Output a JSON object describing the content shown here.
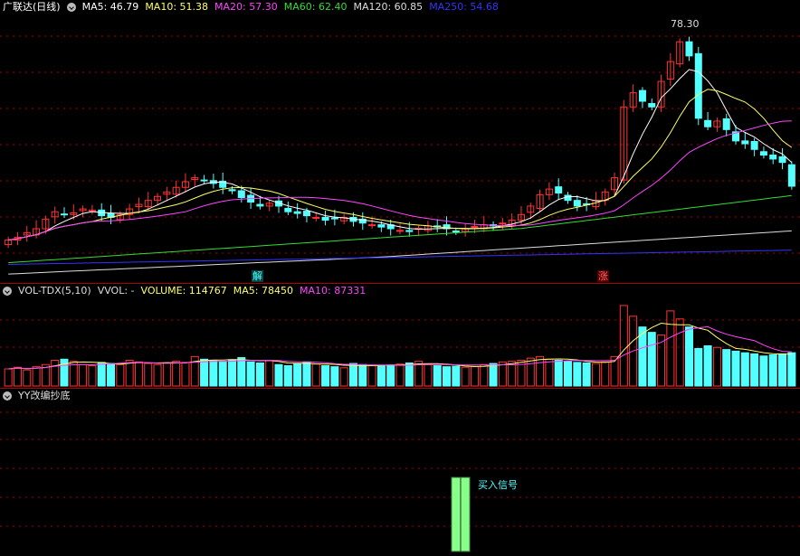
{
  "price_panel": {
    "title": "广联达(日线)",
    "ma_readouts": [
      {
        "label": "MA5: 46.79",
        "color": "#ffffff"
      },
      {
        "label": "MA10: 51.38",
        "color": "#ffff66"
      },
      {
        "label": "MA20: 57.30",
        "color": "#ff44ff"
      },
      {
        "label": "MA60: 62.40",
        "color": "#33dd33"
      },
      {
        "label": "MA120: 60.85",
        "color": "#dddddd"
      },
      {
        "label": "MA250: 54.68",
        "color": "#3333ff"
      }
    ],
    "high_label": "78.30",
    "signal_tags": [
      {
        "text": "解",
        "color": "#55ffff",
        "bg": "#004444"
      },
      {
        "text": "涨",
        "color": "#ff6666",
        "bg": "#550000"
      }
    ]
  },
  "volume_panel": {
    "title": "VOL-TDX(5,10)",
    "readouts": [
      {
        "label": "VVOL: -",
        "color": "#dddddd"
      },
      {
        "label": "VOLUME: 114767",
        "color": "#ffff66"
      },
      {
        "label": "MA5: 78450",
        "color": "#ffff66"
      },
      {
        "label": "MA10: 87331",
        "color": "#ff44ff"
      }
    ]
  },
  "indicator_panel": {
    "title": "YY改编抄底",
    "signal_text": "买入信号"
  },
  "colors": {
    "up": "#ff3333",
    "down": "#54ffff",
    "ma5": "#ffffff",
    "ma10": "#ffff66",
    "ma20": "#ff44ff",
    "ma60": "#33dd33",
    "ma120": "#dddddd",
    "ma250": "#3333ff",
    "grid": "#aa0000",
    "signal_bar": "#88ff88"
  },
  "chart_data": {
    "type": "candlestick",
    "x_count": 85,
    "y_range": [
      36,
      81
    ],
    "closes": [
      41.5,
      42.0,
      42.8,
      43.5,
      45.2,
      46.5,
      46.0,
      46.3,
      47.0,
      46.8,
      45.8,
      45.5,
      46.0,
      47.0,
      47.8,
      48.5,
      49.2,
      50.0,
      50.8,
      51.8,
      52.5,
      52.0,
      51.5,
      50.8,
      50.2,
      49.0,
      48.2,
      47.5,
      48.0,
      47.5,
      46.5,
      46.2,
      45.8,
      45.5,
      45.0,
      45.3,
      45.5,
      44.8,
      44.5,
      44.2,
      43.8,
      43.5,
      43.2,
      43.0,
      43.6,
      44.0,
      43.8,
      43.5,
      43.0,
      43.5,
      43.9,
      44.2,
      44.0,
      44.5,
      45.0,
      46.0,
      47.5,
      49.5,
      50.5,
      49.8,
      48.5,
      47.5,
      47.8,
      48.5,
      50.0,
      52.5,
      65.0,
      67.5,
      66.0,
      65.0,
      69.5,
      73.0,
      76.5,
      74.0,
      63.0,
      61.5,
      62.5,
      61.0,
      59.0,
      58.5,
      57.5,
      56.5,
      55.8,
      55.2,
      51.0
    ],
    "volume": [
      32000,
      35000,
      30000,
      36000,
      40000,
      48000,
      50000,
      46000,
      40000,
      38000,
      44000,
      42000,
      40000,
      48000,
      45000,
      42000,
      40000,
      43000,
      46000,
      44000,
      55000,
      50000,
      47000,
      46000,
      49000,
      53000,
      45000,
      43000,
      48000,
      40000,
      38000,
      42000,
      45000,
      41000,
      38000,
      36000,
      34000,
      42000,
      40000,
      38000,
      37000,
      39000,
      41000,
      43000,
      46000,
      40000,
      38000,
      36000,
      37000,
      35000,
      36000,
      40000,
      42000,
      45000,
      46000,
      48000,
      52000,
      55000,
      50000,
      48000,
      46000,
      44000,
      43000,
      42000,
      45000,
      55000,
      150000,
      130000,
      110000,
      100000,
      95000,
      140000,
      125000,
      110000,
      70000,
      75000,
      72000,
      68000,
      65000,
      62000,
      60000,
      56000,
      58000,
      60000,
      62000
    ],
    "signal_bars_x": [
      48,
      49
    ]
  }
}
